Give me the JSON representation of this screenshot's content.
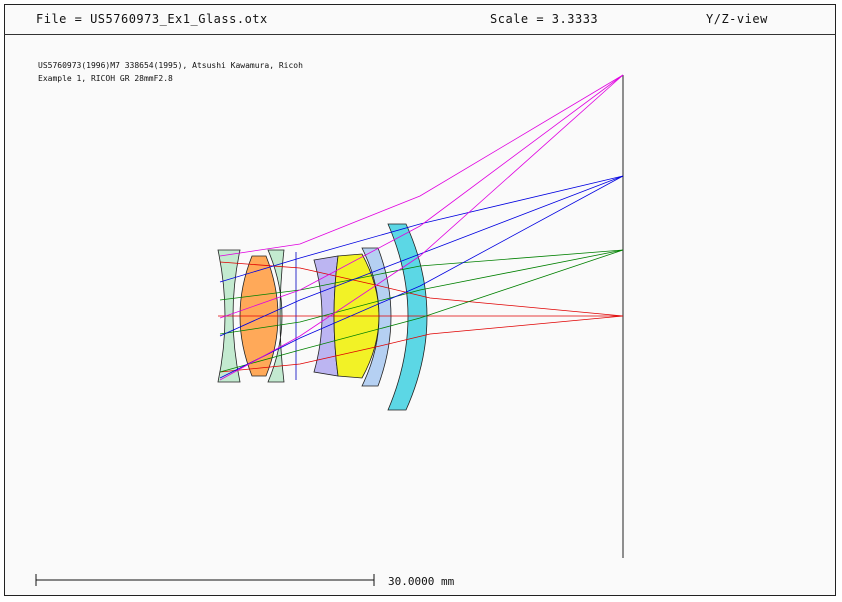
{
  "header": {
    "file_label": "File = US5760973_Ex1_Glass.otx",
    "scale_label": "Scale = 3.3333",
    "view_label": "Y/Z-view"
  },
  "description": {
    "line1": "US5760973(1996)M7 338654(1995), Atsushi Kawamura, Ricoh",
    "line2": "Example 1, RICOH GR 28mmF2.8"
  },
  "scale_bar": {
    "label": "30.0000 mm"
  },
  "colors": {
    "ray_axial": "#e00000",
    "ray_field1": "#008000",
    "ray_field2": "#0000e0",
    "ray_field3": "#e000e0",
    "lens1": "#b8e6c8",
    "lens2": "#ff9a3c",
    "lens3": "#b8e6c8",
    "lens4": "#b0a8f0",
    "lens5": "#f0f000",
    "lens6": "#a8c8f0",
    "lens7": "#40d0e0"
  }
}
